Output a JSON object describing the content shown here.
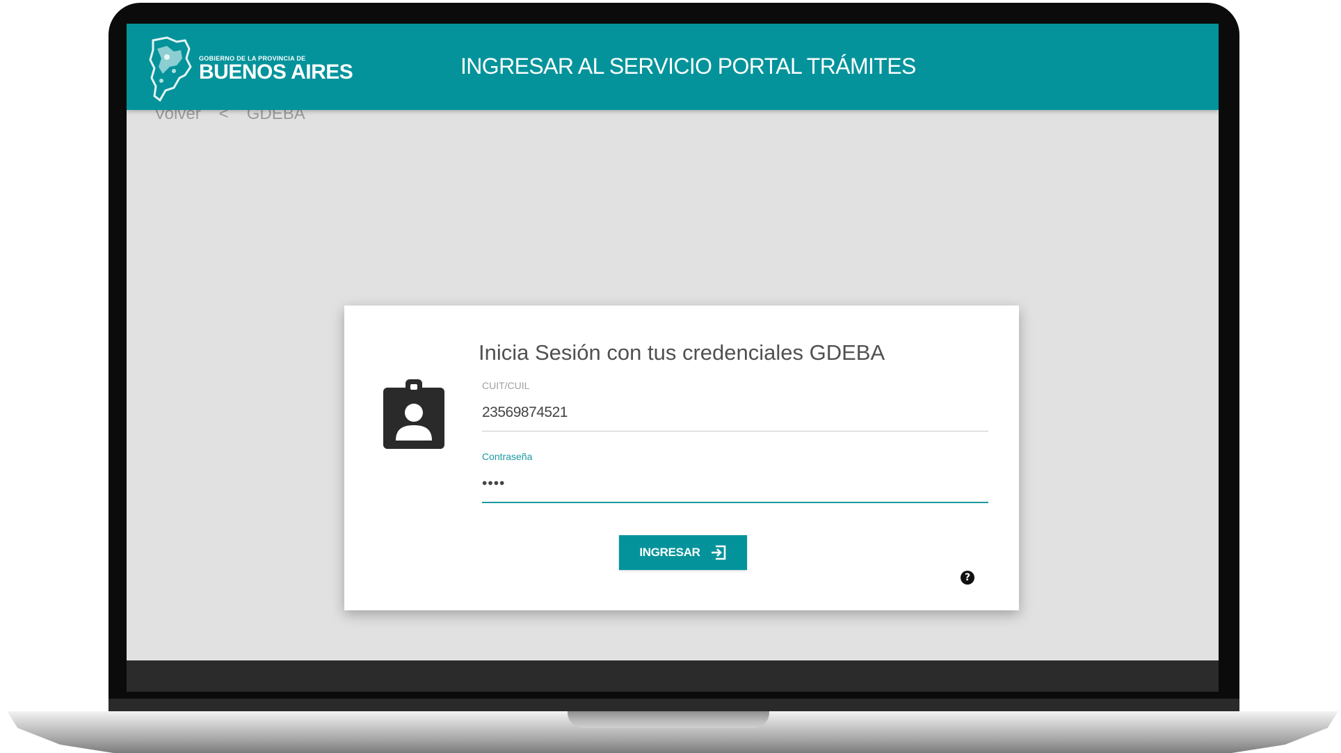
{
  "header": {
    "logo_small": "GOBIERNO DE LA PROVINCIA DE",
    "logo_big": "BUENOS AIRES",
    "title": "INGRESAR AL SERVICIO PORTAL TRÁMITES",
    "color": "#04939b"
  },
  "breadcrumb": {
    "back": "Volver",
    "separator": "<",
    "current": "GDEBA"
  },
  "login": {
    "title": "Inicia Sesión con tus credenciales GDEBA",
    "cuit_label": "CUIT/CUIL",
    "cuit_value": "23569874521",
    "password_label": "Contraseña",
    "password_value": "••••",
    "submit_label": "INGRESAR",
    "submit_icon": "login-icon",
    "help_icon": "help-icon",
    "help_glyph": "?"
  },
  "icons": {
    "badge": "contact-badge-icon",
    "logo_map": "province-map-logo"
  }
}
